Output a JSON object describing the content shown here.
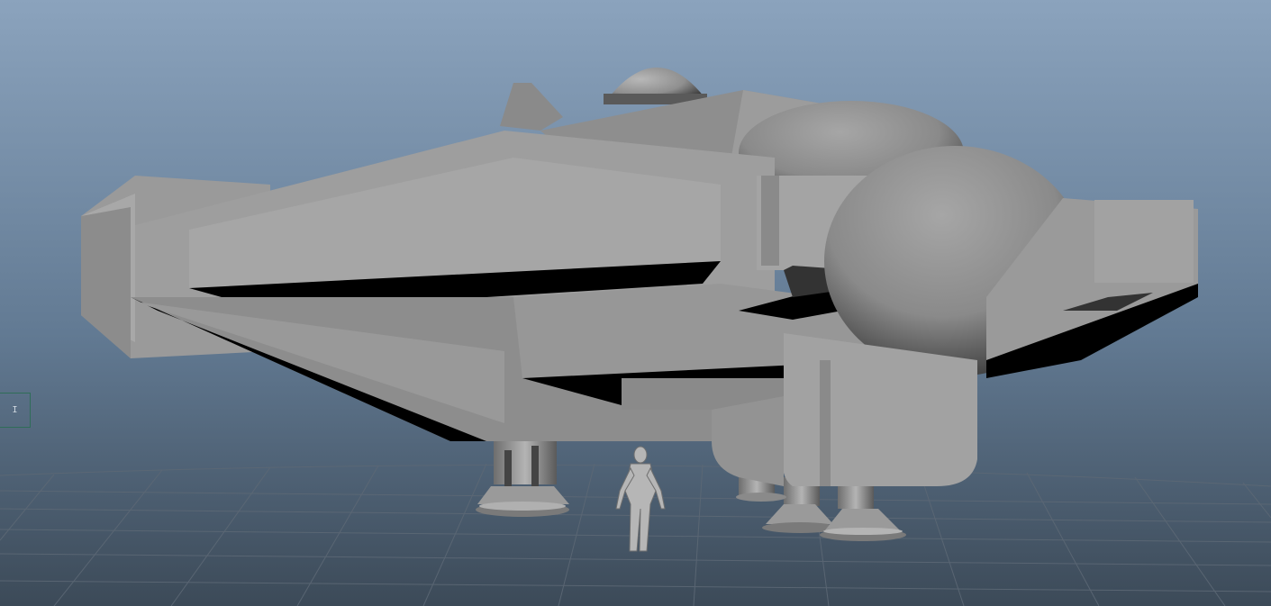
{
  "viewport": {
    "panel_handle_label": "I",
    "background": {
      "top": "#8ba3bd",
      "bottom": "#3c4a58"
    },
    "grid_color": "#5c6875",
    "model_color": "#9a9a9a",
    "shadow_color": "#000000"
  }
}
